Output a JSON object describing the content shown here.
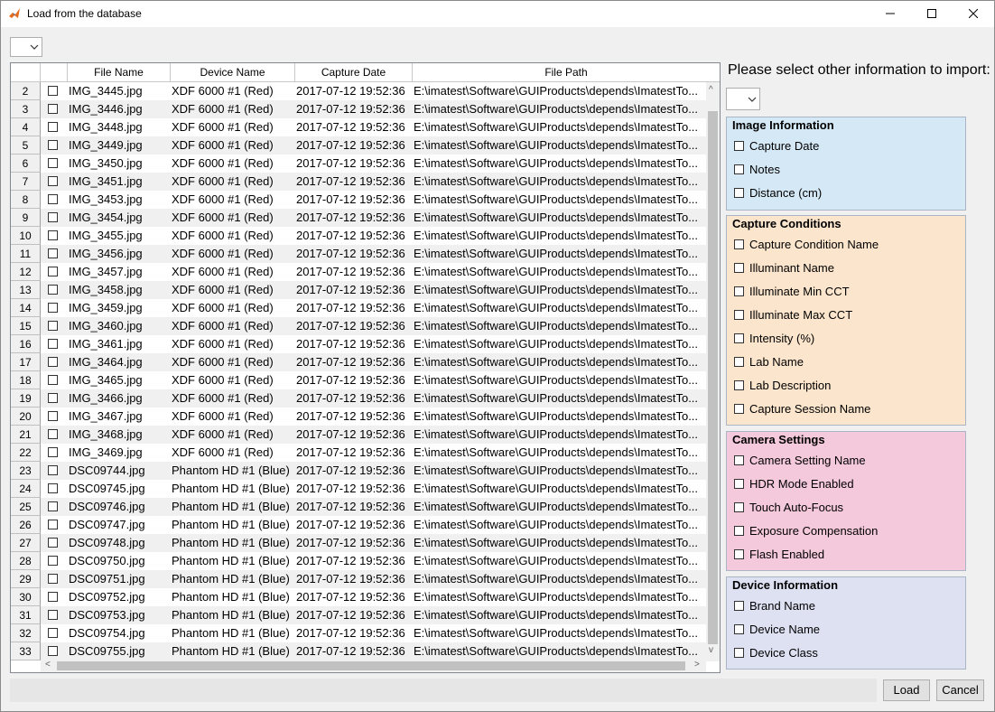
{
  "window": {
    "title": "Load from the database"
  },
  "table": {
    "columns": [
      "File Name",
      "Device Name",
      "Capture Date",
      "File Path"
    ],
    "rows": [
      {
        "n": "2",
        "file": "IMG_3445.jpg",
        "device": "XDF 6000 #1 (Red)",
        "date": "2017-07-12 19:52:36",
        "path": "E:\\imatest\\Software\\GUIProducts\\depends\\ImatestTo..."
      },
      {
        "n": "3",
        "file": "IMG_3446.jpg",
        "device": "XDF 6000 #1 (Red)",
        "date": "2017-07-12 19:52:36",
        "path": "E:\\imatest\\Software\\GUIProducts\\depends\\ImatestTo..."
      },
      {
        "n": "4",
        "file": "IMG_3448.jpg",
        "device": "XDF 6000 #1 (Red)",
        "date": "2017-07-12 19:52:36",
        "path": "E:\\imatest\\Software\\GUIProducts\\depends\\ImatestTo..."
      },
      {
        "n": "5",
        "file": "IMG_3449.jpg",
        "device": "XDF 6000 #1 (Red)",
        "date": "2017-07-12 19:52:36",
        "path": "E:\\imatest\\Software\\GUIProducts\\depends\\ImatestTo..."
      },
      {
        "n": "6",
        "file": "IMG_3450.jpg",
        "device": "XDF 6000 #1 (Red)",
        "date": "2017-07-12 19:52:36",
        "path": "E:\\imatest\\Software\\GUIProducts\\depends\\ImatestTo..."
      },
      {
        "n": "7",
        "file": "IMG_3451.jpg",
        "device": "XDF 6000 #1 (Red)",
        "date": "2017-07-12 19:52:36",
        "path": "E:\\imatest\\Software\\GUIProducts\\depends\\ImatestTo..."
      },
      {
        "n": "8",
        "file": "IMG_3453.jpg",
        "device": "XDF 6000 #1 (Red)",
        "date": "2017-07-12 19:52:36",
        "path": "E:\\imatest\\Software\\GUIProducts\\depends\\ImatestTo..."
      },
      {
        "n": "9",
        "file": "IMG_3454.jpg",
        "device": "XDF 6000 #1 (Red)",
        "date": "2017-07-12 19:52:36",
        "path": "E:\\imatest\\Software\\GUIProducts\\depends\\ImatestTo..."
      },
      {
        "n": "10",
        "file": "IMG_3455.jpg",
        "device": "XDF 6000 #1 (Red)",
        "date": "2017-07-12 19:52:36",
        "path": "E:\\imatest\\Software\\GUIProducts\\depends\\ImatestTo..."
      },
      {
        "n": "11",
        "file": "IMG_3456.jpg",
        "device": "XDF 6000 #1 (Red)",
        "date": "2017-07-12 19:52:36",
        "path": "E:\\imatest\\Software\\GUIProducts\\depends\\ImatestTo..."
      },
      {
        "n": "12",
        "file": "IMG_3457.jpg",
        "device": "XDF 6000 #1 (Red)",
        "date": "2017-07-12 19:52:36",
        "path": "E:\\imatest\\Software\\GUIProducts\\depends\\ImatestTo..."
      },
      {
        "n": "13",
        "file": "IMG_3458.jpg",
        "device": "XDF 6000 #1 (Red)",
        "date": "2017-07-12 19:52:36",
        "path": "E:\\imatest\\Software\\GUIProducts\\depends\\ImatestTo..."
      },
      {
        "n": "14",
        "file": "IMG_3459.jpg",
        "device": "XDF 6000 #1 (Red)",
        "date": "2017-07-12 19:52:36",
        "path": "E:\\imatest\\Software\\GUIProducts\\depends\\ImatestTo..."
      },
      {
        "n": "15",
        "file": "IMG_3460.jpg",
        "device": "XDF 6000 #1 (Red)",
        "date": "2017-07-12 19:52:36",
        "path": "E:\\imatest\\Software\\GUIProducts\\depends\\ImatestTo..."
      },
      {
        "n": "16",
        "file": "IMG_3461.jpg",
        "device": "XDF 6000 #1 (Red)",
        "date": "2017-07-12 19:52:36",
        "path": "E:\\imatest\\Software\\GUIProducts\\depends\\ImatestTo..."
      },
      {
        "n": "17",
        "file": "IMG_3464.jpg",
        "device": "XDF 6000 #1 (Red)",
        "date": "2017-07-12 19:52:36",
        "path": "E:\\imatest\\Software\\GUIProducts\\depends\\ImatestTo..."
      },
      {
        "n": "18",
        "file": "IMG_3465.jpg",
        "device": "XDF 6000 #1 (Red)",
        "date": "2017-07-12 19:52:36",
        "path": "E:\\imatest\\Software\\GUIProducts\\depends\\ImatestTo..."
      },
      {
        "n": "19",
        "file": "IMG_3466.jpg",
        "device": "XDF 6000 #1 (Red)",
        "date": "2017-07-12 19:52:36",
        "path": "E:\\imatest\\Software\\GUIProducts\\depends\\ImatestTo..."
      },
      {
        "n": "20",
        "file": "IMG_3467.jpg",
        "device": "XDF 6000 #1 (Red)",
        "date": "2017-07-12 19:52:36",
        "path": "E:\\imatest\\Software\\GUIProducts\\depends\\ImatestTo..."
      },
      {
        "n": "21",
        "file": "IMG_3468.jpg",
        "device": "XDF 6000 #1 (Red)",
        "date": "2017-07-12 19:52:36",
        "path": "E:\\imatest\\Software\\GUIProducts\\depends\\ImatestTo..."
      },
      {
        "n": "22",
        "file": "IMG_3469.jpg",
        "device": "XDF 6000 #1 (Red)",
        "date": "2017-07-12 19:52:36",
        "path": "E:\\imatest\\Software\\GUIProducts\\depends\\ImatestTo..."
      },
      {
        "n": "23",
        "file": "DSC09744.jpg",
        "device": "Phantom HD #1 (Blue)",
        "date": "2017-07-12 19:52:36",
        "path": "E:\\imatest\\Software\\GUIProducts\\depends\\ImatestTo..."
      },
      {
        "n": "24",
        "file": "DSC09745.jpg",
        "device": "Phantom HD #1 (Blue)",
        "date": "2017-07-12 19:52:36",
        "path": "E:\\imatest\\Software\\GUIProducts\\depends\\ImatestTo..."
      },
      {
        "n": "25",
        "file": "DSC09746.jpg",
        "device": "Phantom HD #1 (Blue)",
        "date": "2017-07-12 19:52:36",
        "path": "E:\\imatest\\Software\\GUIProducts\\depends\\ImatestTo..."
      },
      {
        "n": "26",
        "file": "DSC09747.jpg",
        "device": "Phantom HD #1 (Blue)",
        "date": "2017-07-12 19:52:36",
        "path": "E:\\imatest\\Software\\GUIProducts\\depends\\ImatestTo..."
      },
      {
        "n": "27",
        "file": "DSC09748.jpg",
        "device": "Phantom HD #1 (Blue)",
        "date": "2017-07-12 19:52:36",
        "path": "E:\\imatest\\Software\\GUIProducts\\depends\\ImatestTo..."
      },
      {
        "n": "28",
        "file": "DSC09750.jpg",
        "device": "Phantom HD #1 (Blue)",
        "date": "2017-07-12 19:52:36",
        "path": "E:\\imatest\\Software\\GUIProducts\\depends\\ImatestTo..."
      },
      {
        "n": "29",
        "file": "DSC09751.jpg",
        "device": "Phantom HD #1 (Blue)",
        "date": "2017-07-12 19:52:36",
        "path": "E:\\imatest\\Software\\GUIProducts\\depends\\ImatestTo..."
      },
      {
        "n": "30",
        "file": "DSC09752.jpg",
        "device": "Phantom HD #1 (Blue)",
        "date": "2017-07-12 19:52:36",
        "path": "E:\\imatest\\Software\\GUIProducts\\depends\\ImatestTo..."
      },
      {
        "n": "31",
        "file": "DSC09753.jpg",
        "device": "Phantom HD #1 (Blue)",
        "date": "2017-07-12 19:52:36",
        "path": "E:\\imatest\\Software\\GUIProducts\\depends\\ImatestTo..."
      },
      {
        "n": "32",
        "file": "DSC09754.jpg",
        "device": "Phantom HD #1 (Blue)",
        "date": "2017-07-12 19:52:36",
        "path": "E:\\imatest\\Software\\GUIProducts\\depends\\ImatestTo..."
      },
      {
        "n": "33",
        "file": "DSC09755.jpg",
        "device": "Phantom HD #1 (Blue)",
        "date": "2017-07-12 19:52:36",
        "path": "E:\\imatest\\Software\\GUIProducts\\depends\\ImatestTo..."
      }
    ]
  },
  "side": {
    "prompt": "Please select other information to import:",
    "panels": [
      {
        "title": "Image Information",
        "color": "#d5e8f6",
        "items": [
          "Capture Date",
          "Notes",
          "Distance (cm)"
        ]
      },
      {
        "title": "Capture Conditions",
        "color": "#fbe5cc",
        "items": [
          "Capture Condition Name",
          "Illuminant Name",
          "Illuminate Min CCT",
          "Illuminate Max CCT",
          "Intensity (%)",
          "Lab Name",
          "Lab Description",
          "Capture Session Name"
        ]
      },
      {
        "title": "Camera Settings",
        "color": "#f5c9dc",
        "items": [
          "Camera Setting Name",
          "HDR Mode Enabled",
          "Touch Auto-Focus",
          "Exposure Compensation",
          "Flash Enabled"
        ]
      },
      {
        "title": "Device Information",
        "color": "#dde1f2",
        "items": [
          "Brand Name",
          "Device Name",
          "Device Class"
        ]
      }
    ]
  },
  "buttons": {
    "load": "Load",
    "cancel": "Cancel"
  },
  "icons": {
    "app": "matlab-icon",
    "minimize": "minimize-icon",
    "maximize": "maximize-icon",
    "close": "close-icon"
  }
}
